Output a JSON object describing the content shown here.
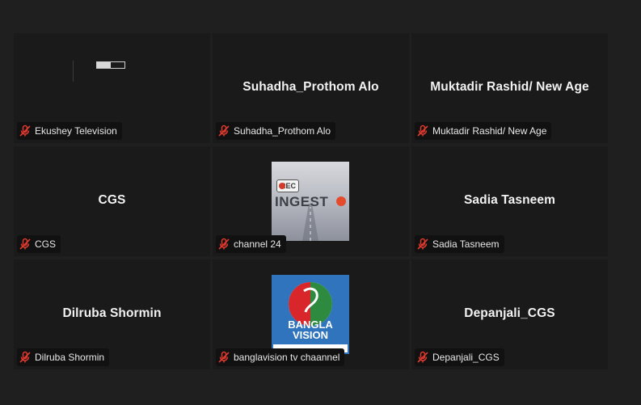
{
  "tiles": [
    {
      "center_name": "",
      "tag": "Ekushey Television"
    },
    {
      "center_name": "Suhadha_Prothom Alo",
      "tag": "Suhadha_Prothom Alo"
    },
    {
      "center_name": "Muktadir Rashid/ New Age",
      "tag": "Muktadir Rashid/ New Age"
    },
    {
      "center_name": "CGS",
      "tag": "CGS"
    },
    {
      "center_name": "",
      "tag": "channel 24",
      "thumb_text": {
        "rec": "REC",
        "word": "INGEST"
      }
    },
    {
      "center_name": "Sadia Tasneem",
      "tag": "Sadia Tasneem"
    },
    {
      "center_name": "Dilruba Shormin",
      "tag": "Dilruba Shormin"
    },
    {
      "center_name": "",
      "tag": "banglavision tv chaannel",
      "thumb_text": {
        "line1": "BANGLA",
        "line2": "VISION"
      }
    },
    {
      "center_name": "Depanjali_CGS",
      "tag": "Depanjali_CGS"
    }
  ],
  "icons": {
    "mic": "mic-muted-icon"
  },
  "colors": {
    "background": "#1f1f1f",
    "tile": "#1a1a1a",
    "muted_icon": "#e03a2f",
    "brand_blue": "#2f74bd"
  }
}
